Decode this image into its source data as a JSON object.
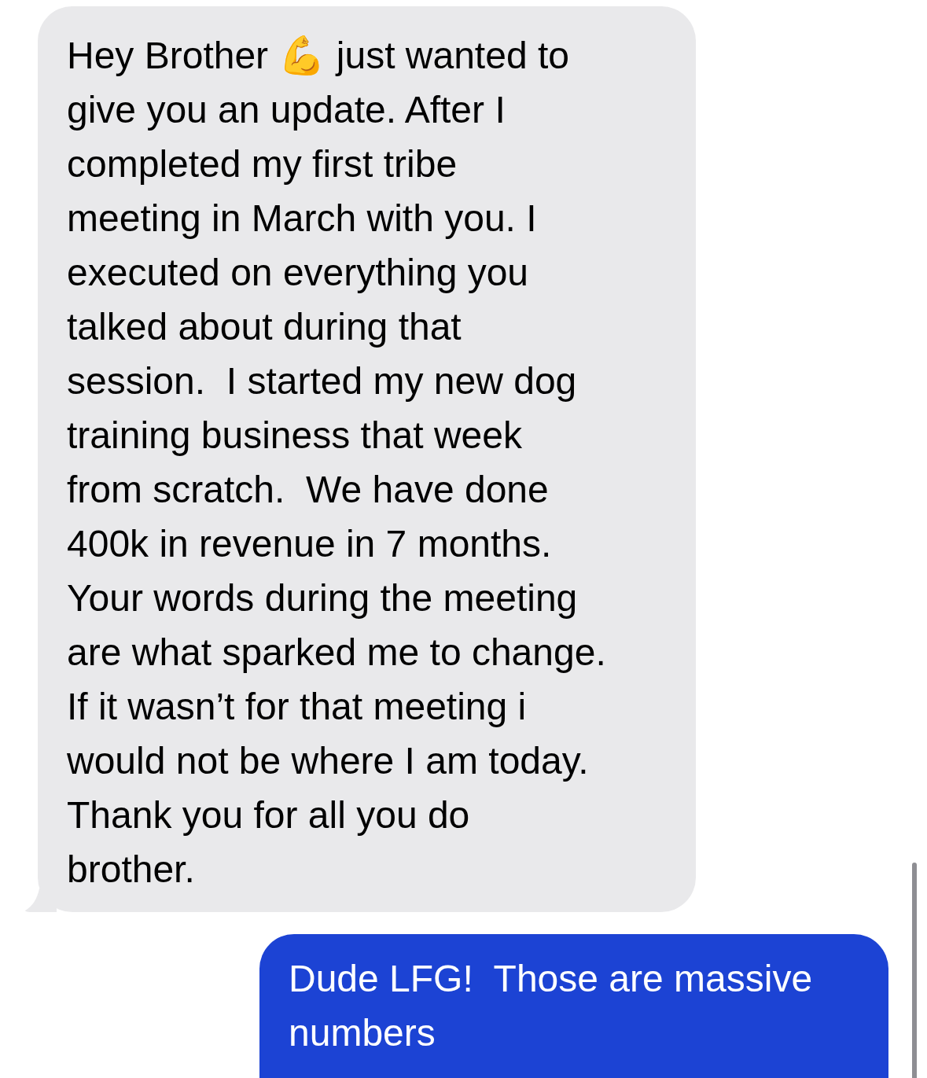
{
  "messages": [
    {
      "kind": "incoming",
      "text": "Hey Brother 💪 just wanted to\ngive you an update. After I\ncompleted my first tribe\nmeeting in March with you. I\nexecuted on everything you\ntalked about during that\nsession.  I started my new dog\ntraining business that week\nfrom scratch.  We have done\n400k in revenue in 7 months.\nYour words during the meeting\nare what sparked me to change.\nIf it wasn’t for that meeting i\nwould not be where I am today.\nThank you for all you do\nbrother."
    },
    {
      "kind": "outgoing",
      "text": "Dude LFG!  Those are massive\nnumbers"
    }
  ]
}
